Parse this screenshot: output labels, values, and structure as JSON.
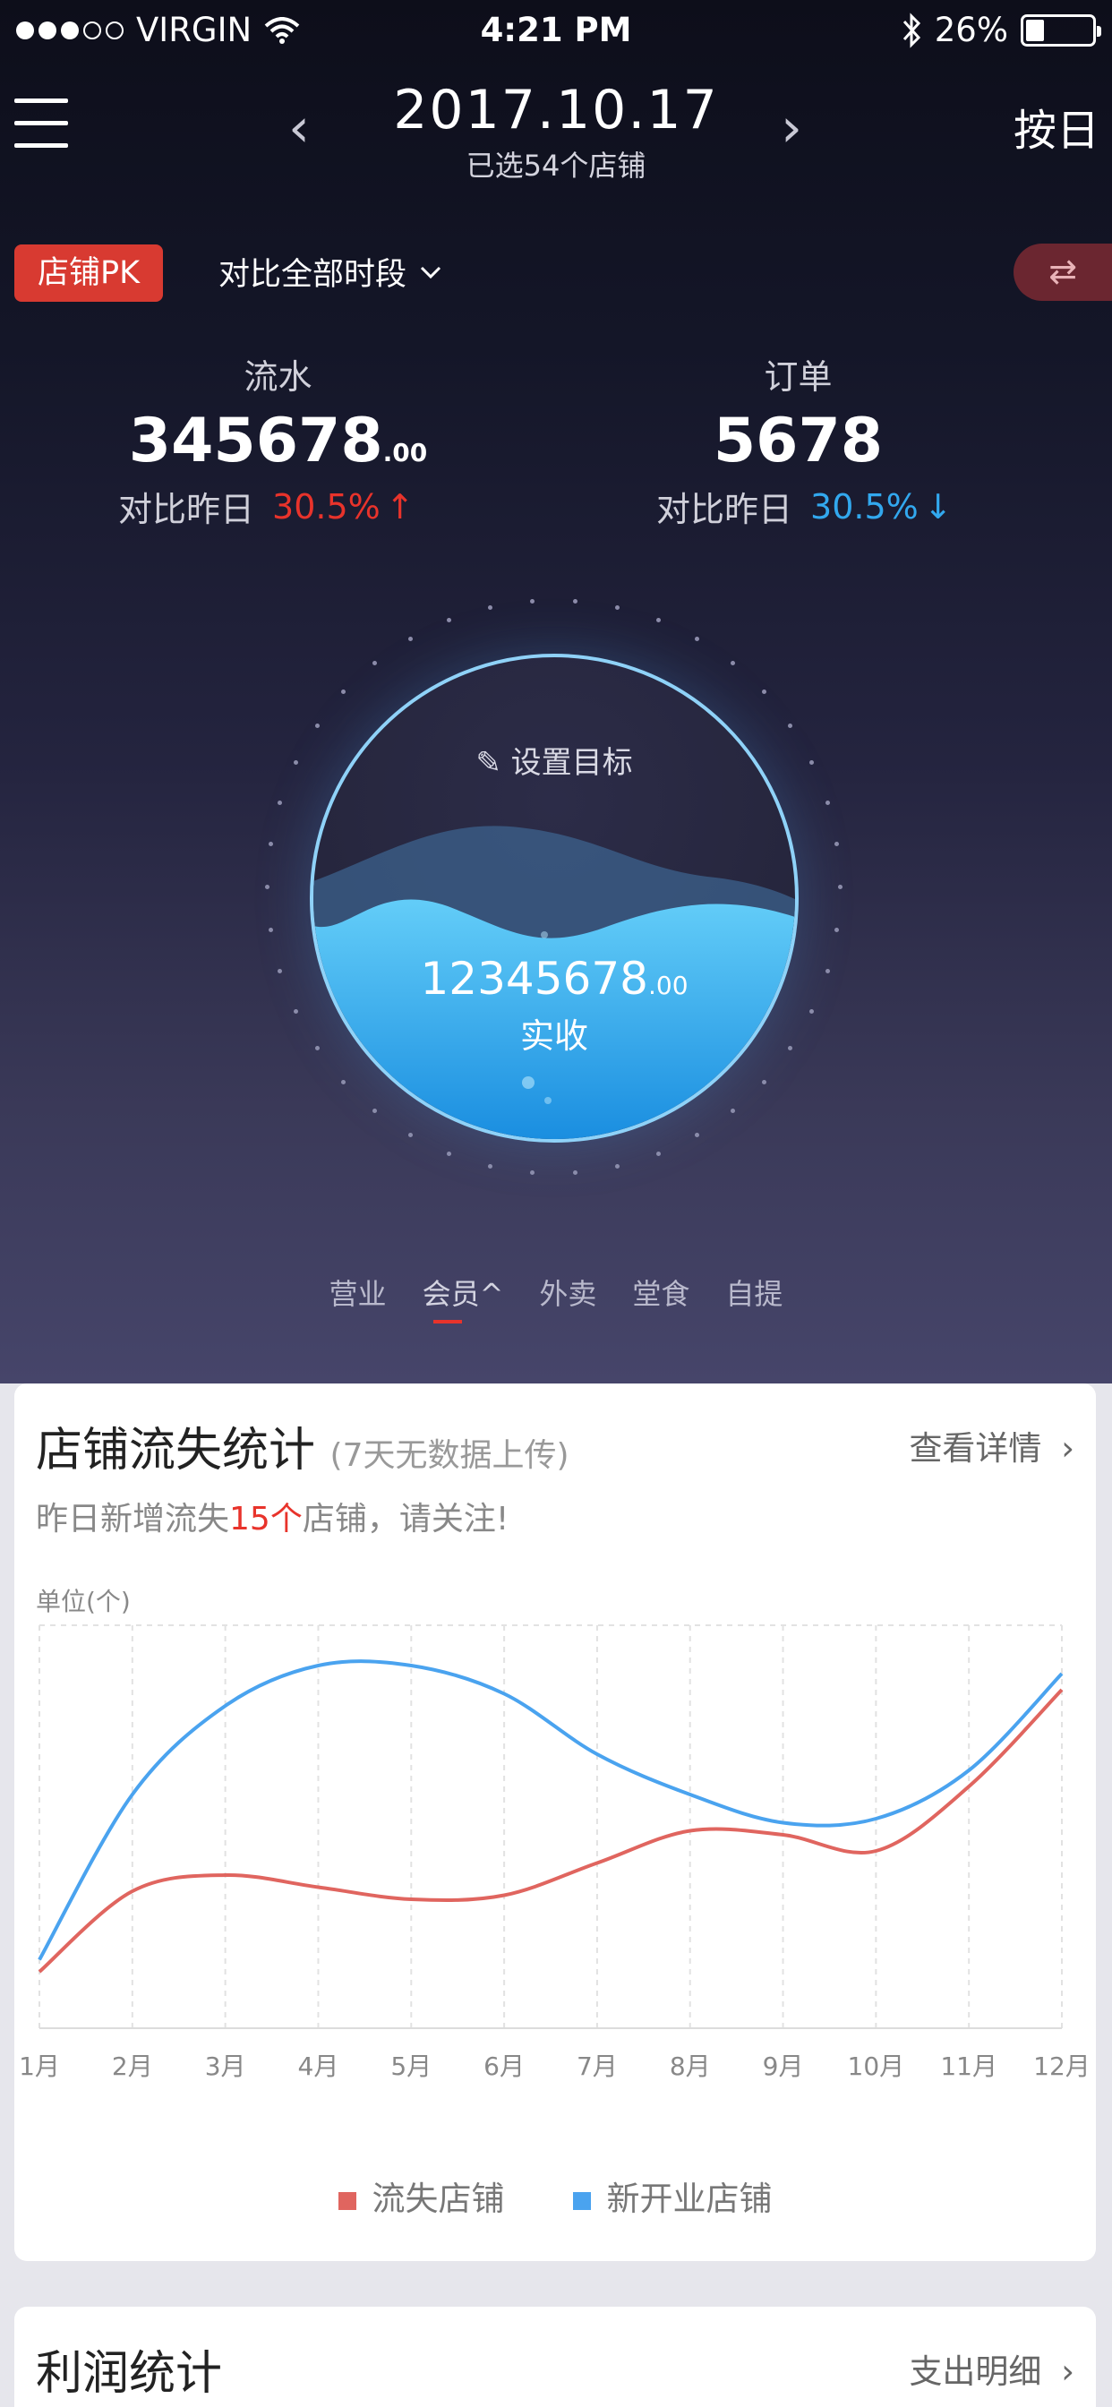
{
  "status_bar": {
    "carrier": "VIRGIN",
    "time": "4:21 PM",
    "battery": "26%",
    "battery_level": 0.26
  },
  "header": {
    "date": "2017.10.17",
    "subtitle": "已选54个店铺",
    "mode_button": "按日",
    "prev_icon": "chevron-left-icon",
    "next_icon": "chevron-right-icon"
  },
  "controls": {
    "pk_label": "店铺PK",
    "compare_label": "对比全部时段",
    "swap_icon": "swap-icon"
  },
  "metrics": {
    "revenue": {
      "label": "流水",
      "value": "345678",
      "decimals": ".00",
      "compare_label": "对比昨日",
      "change": "30.5%",
      "direction": "up"
    },
    "orders": {
      "label": "订单",
      "value": "5678",
      "compare_label": "对比昨日",
      "change": "30.5%",
      "direction": "down"
    }
  },
  "goal": {
    "set_label": "设置目标",
    "value": "12345678",
    "decimals": ".00",
    "label": "实收"
  },
  "tabs": [
    {
      "label": "营业"
    },
    {
      "label": "会员^",
      "active": true
    },
    {
      "label": "外卖"
    },
    {
      "label": "堂食"
    },
    {
      "label": "自提"
    }
  ],
  "churn_card": {
    "title": "店铺流失统计",
    "subtitle": "(7天无数据上传)",
    "link": "查看详情",
    "notice_prefix": "昨日新增流失",
    "notice_count": "15个",
    "notice_suffix": "店铺，请关注!",
    "unit": "单位(个)"
  },
  "chart_data": {
    "type": "line",
    "x": [
      "1月",
      "2月",
      "3月",
      "4月",
      "5月",
      "6月",
      "7月",
      "8月",
      "9月",
      "10月",
      "11月",
      "12月"
    ],
    "ylim": [
      0,
      100
    ],
    "series": [
      {
        "name": "流失店铺",
        "color": "#e0655f",
        "values": [
          14,
          34,
          38,
          35,
          32,
          33,
          41,
          49,
          48,
          44,
          60,
          84
        ]
      },
      {
        "name": "新开业店铺",
        "color": "#4aa3ef",
        "values": [
          17,
          58,
          80,
          90,
          90,
          83,
          68,
          58,
          51,
          52,
          64,
          88
        ]
      }
    ]
  },
  "profit_card": {
    "title": "利润统计",
    "link": "支出明细"
  }
}
